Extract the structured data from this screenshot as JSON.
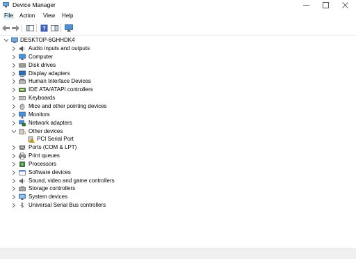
{
  "window": {
    "title": "Device Manager"
  },
  "menu": {
    "file": "File",
    "action": "Action",
    "view": "View",
    "help": "Help"
  },
  "tree": {
    "root": "DESKTOP-6GHHDK4",
    "categories": [
      {
        "label": "Audio inputs and outputs",
        "icon": "speaker-icon"
      },
      {
        "label": "Computer",
        "icon": "computer-icon"
      },
      {
        "label": "Disk drives",
        "icon": "disk-icon"
      },
      {
        "label": "Display adapters",
        "icon": "display-icon"
      },
      {
        "label": "Human Interface Devices",
        "icon": "hid-icon"
      },
      {
        "label": "IDE ATA/ATAPI controllers",
        "icon": "ide-icon"
      },
      {
        "label": "Keyboards",
        "icon": "keyboard-icon"
      },
      {
        "label": "Mice and other pointing devices",
        "icon": "mouse-icon"
      },
      {
        "label": "Monitors",
        "icon": "monitor-icon"
      },
      {
        "label": "Network adapters",
        "icon": "network-icon"
      },
      {
        "label": "Other devices",
        "icon": "other-devices-icon",
        "expanded": true
      },
      {
        "label": "PCI Serial Port",
        "icon": "warning-device-icon",
        "child": true
      },
      {
        "label": "Ports (COM & LPT)",
        "icon": "port-icon"
      },
      {
        "label": "Print queues",
        "icon": "printer-icon"
      },
      {
        "label": "Processors",
        "icon": "processor-icon"
      },
      {
        "label": "Software devices",
        "icon": "software-icon"
      },
      {
        "label": "Sound, video and game controllers",
        "icon": "sound-icon"
      },
      {
        "label": "Storage controllers",
        "icon": "storage-icon"
      },
      {
        "label": "System devices",
        "icon": "system-icon"
      },
      {
        "label": "Universal Serial Bus controllers",
        "icon": "usb-icon"
      }
    ]
  }
}
